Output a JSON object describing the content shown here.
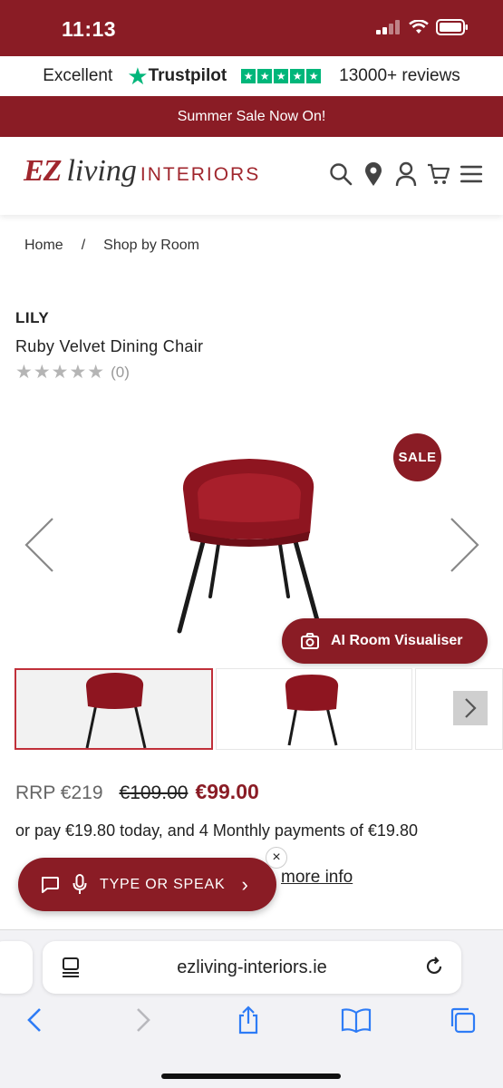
{
  "status_bar": {
    "time": "11:13"
  },
  "trustpilot": {
    "rating_word": "Excellent",
    "brand": "Trustpilot",
    "reviews": "13000+ reviews"
  },
  "promo_banner": "Summer Sale Now On!",
  "header": {
    "logo_ez": "EZ",
    "logo_living": "living",
    "logo_interiors": "INTERIORS",
    "icons": [
      "search-icon",
      "location-pin-icon",
      "account-icon",
      "cart-icon",
      "menu-icon"
    ]
  },
  "breadcrumb": {
    "home": "Home",
    "separator": "/",
    "current": "Shop by Room"
  },
  "product": {
    "brand": "LILY",
    "name": "Ruby Velvet Dining Chair",
    "stars": "★★★★★",
    "rating_count": "(0)",
    "sale_badge": "SALE",
    "rating_value": 0,
    "rating_max": 5
  },
  "visualiser_button": "AI Room Visualiser",
  "pricing": {
    "rrp": "RRP €219",
    "was": "€109.00",
    "now": "€99.00",
    "installment_text": "or pay €19.80 today, and 4 Monthly payments of €19.80",
    "more_info": "more info"
  },
  "chat_widget": {
    "label": "TYPE OR SPEAK",
    "chevron": "›",
    "close": "×"
  },
  "browser": {
    "url": "ezliving-interiors.ie"
  },
  "colors": {
    "brand": "#8a1c25",
    "trustpilot_green": "#00b67a",
    "active_thumb_border": "#c0303a"
  }
}
